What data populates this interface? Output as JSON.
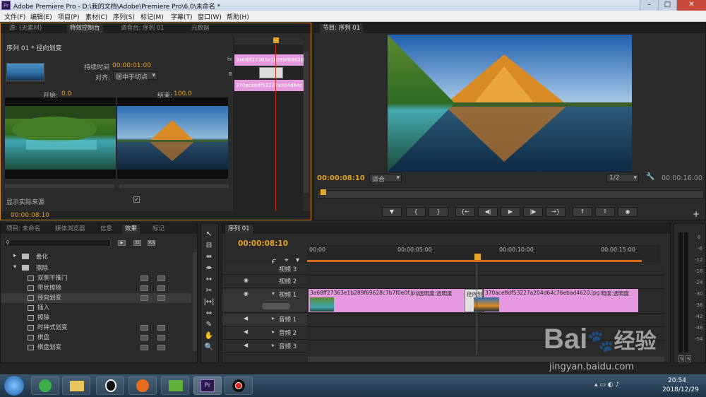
{
  "titlebar": {
    "title": "Adobe Premiere Pro - D:\\我的文档\\Adobe\\Premiere Pro\\6.0\\未命名 *",
    "minimize": "–",
    "maximize": "□",
    "close": "✕"
  },
  "menu": [
    "文件(F)",
    "编辑(E)",
    "项目(P)",
    "素材(C)",
    "序列(S)",
    "标记(M)",
    "字幕(T)",
    "窗口(W)",
    "帮助(H)"
  ],
  "left_tabs": [
    "源: (无素材)",
    "特效控制台",
    "调音台: 序列 01",
    "元数据"
  ],
  "effect_controls": {
    "header": "序列 01 * 径向划变",
    "duration_label": "持续时间",
    "duration_value": "00:00:01:00",
    "align_label": "对齐:",
    "align_value": "居中于切点",
    "start_label": "开始:",
    "start_value": "0.0",
    "end_label": "结束:",
    "end_value": "100.0",
    "show_source_label": "显示实际来源",
    "clip_a": "3a68ff27363e1b289f69628c7b7f0e0f.jpg",
    "clip_b": "370ace8df53227a204d64c76ebad4620.jpg",
    "timecode": "00:00:08:10",
    "fx_label": "fx",
    "b_label": "B"
  },
  "program": {
    "tab": "节目: 序列 01",
    "timecode": "00:00:08:10",
    "fit": "适合",
    "quality": "1/2",
    "duration": "00:00:16:00"
  },
  "transport_buttons": [
    "mark-in",
    "in-point",
    "out-point",
    "go-to-in",
    "step-back",
    "play",
    "step-forward",
    "go-to-out",
    "lift",
    "extract",
    "export-frame"
  ],
  "project_tabs": [
    "项目: 未命名",
    "媒体浏览器",
    "信息",
    "效果",
    "标记"
  ],
  "effects_tree": {
    "search_placeholder": "",
    "badges": [
      "32",
      "YUV"
    ],
    "folders": [
      "叠化",
      "擦除"
    ],
    "items": [
      "双侧平推门",
      "带状擦除",
      "径向划变",
      "插入",
      "擦除",
      "时钟式划变",
      "棋盘",
      "棋盘划变"
    ]
  },
  "timeline": {
    "tab": "序列 01",
    "timecode": "00:00:08:10",
    "ruler": [
      "00:00",
      "00:00:05:00",
      "00:00:10:00",
      "00:00:15:00"
    ],
    "tracks": [
      "视频 3",
      "视频 2",
      "视频 1",
      "音频 1",
      "音频 2",
      "音频 3"
    ],
    "clip1_label": "3a68ff27363e1b289f69628c7b7f0e0f.jpg",
    "clip1_fx": "透明度:透明度",
    "transition_label": "径向划",
    "clip2_label": "370ace8df53227a204d64c76ebad4620.jpg",
    "clip2_fx": "明度:透明度"
  },
  "vu_meter": {
    "ticks": [
      "0",
      "-6",
      "-12",
      "-18",
      "-24",
      "-30",
      "-36",
      "-42",
      "-48",
      "-54"
    ],
    "solo": "S"
  },
  "watermark": {
    "text": "Bai",
    "text2": "经验",
    "url": "jingyan.baidu.com"
  },
  "taskbar": {
    "time": "20:54",
    "date": "2018/12/29",
    "pr": "Pr"
  }
}
